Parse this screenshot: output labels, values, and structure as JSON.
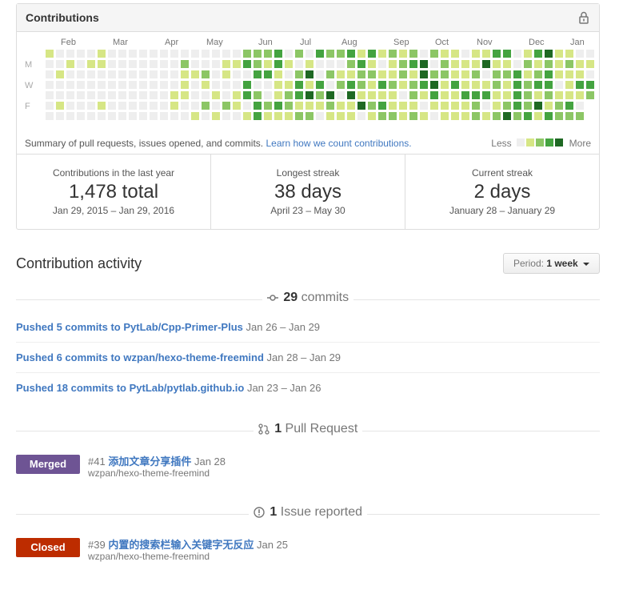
{
  "contributions": {
    "title": "Contributions",
    "months": [
      "Feb",
      "Mar",
      "Apr",
      "May",
      "Jun",
      "Jul",
      "Aug",
      "Sep",
      "Oct",
      "Nov",
      "Dec",
      "Jan"
    ],
    "day_labels": [
      "M",
      "W",
      "F"
    ],
    "summary_text": "Summary of pull requests, issues opened, and commits.",
    "learn_link": "Learn how we count contributions.",
    "legend_less": "Less",
    "legend_more": "More",
    "palette": [
      "#eeeeee",
      "#d6e685",
      "#8cc665",
      "#44a340",
      "#1e6823"
    ]
  },
  "stats": [
    {
      "label": "Contributions in the last year",
      "value": "1,478 total",
      "range": "Jan 29, 2015 – Jan 29, 2016"
    },
    {
      "label": "Longest streak",
      "value": "38 days",
      "range": "April 23 – May 30"
    },
    {
      "label": "Current streak",
      "value": "2 days",
      "range": "January 28 – January 29"
    }
  ],
  "activity": {
    "title": "Contribution activity",
    "period_label": "Period:",
    "period_value": "1 week"
  },
  "commits_section": {
    "count": "29",
    "label": "commits",
    "rows": [
      {
        "text": "Pushed 5 commits to PytLab/Cpp-Primer-Plus",
        "dates": "Jan 26 – Jan 29"
      },
      {
        "text": "Pushed 6 commits to wzpan/hexo-theme-freemind",
        "dates": "Jan 28 – Jan 29"
      },
      {
        "text": "Pushed 18 commits to PytLab/pytlab.github.io",
        "dates": "Jan 23 – Jan 26"
      }
    ]
  },
  "pr_section": {
    "count": "1",
    "label": "Pull Request",
    "badge": "Merged",
    "badge_color": "#6e5494",
    "number": "#41",
    "title": "添加文章分享插件",
    "date": "Jan 28",
    "repo": "wzpan/hexo-theme-freemind"
  },
  "issue_section": {
    "count": "1",
    "label": "Issue reported",
    "badge": "Closed",
    "badge_color": "#bd2c00",
    "number": "#39",
    "title": "内置的搜索栏输入关键字无反应",
    "date": "Jan 25",
    "repo": "wzpan/hexo-theme-freemind"
  }
}
